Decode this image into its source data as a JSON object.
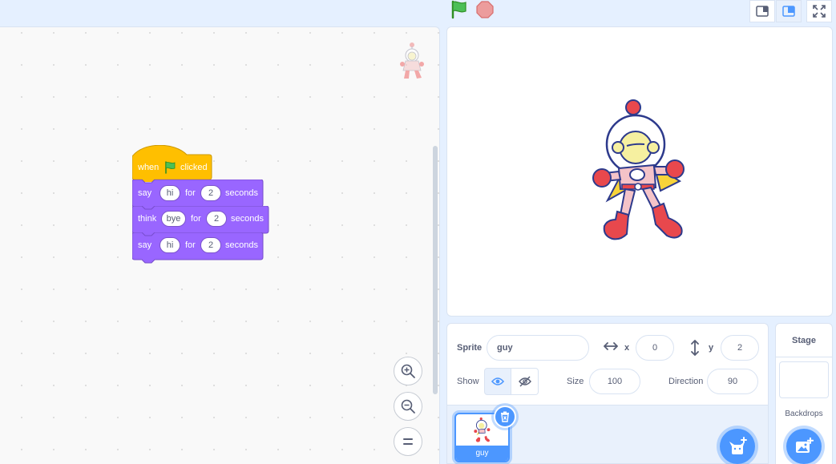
{
  "toolbar": {
    "green_flag": "green-flag-icon",
    "stop": "stop-icon",
    "small_stage": "small-stage-icon",
    "normal_stage": "normal-stage-icon",
    "fullscreen": "fullscreen-icon"
  },
  "script": {
    "hat": {
      "word1": "when",
      "word2": "clicked"
    },
    "blocks": [
      {
        "verb": "say",
        "message": "hi",
        "for": "for",
        "secs": "2",
        "unit": "seconds"
      },
      {
        "verb": "think",
        "message": "bye",
        "for": "for",
        "secs": "2",
        "unit": "seconds"
      },
      {
        "verb": "say",
        "message": "hi",
        "for": "for",
        "secs": "2",
        "unit": "seconds"
      }
    ]
  },
  "sprite_info": {
    "sprite_label": "Sprite",
    "sprite_name": "guy",
    "x_label": "x",
    "x_value": "0",
    "y_label": "y",
    "y_value": "2",
    "show_label": "Show",
    "size_label": "Size",
    "size_value": "100",
    "direction_label": "Direction",
    "direction_value": "90"
  },
  "sprite_list": {
    "items": [
      {
        "name": "guy",
        "selected": true
      }
    ]
  },
  "stage_pane": {
    "title": "Stage",
    "backdrops_label": "Backdrops"
  },
  "colors": {
    "motion_blue": "#4c97ff",
    "looks_purple": "#9966ff",
    "events_yellow": "#ffbf00",
    "background": "#e5f0ff"
  }
}
